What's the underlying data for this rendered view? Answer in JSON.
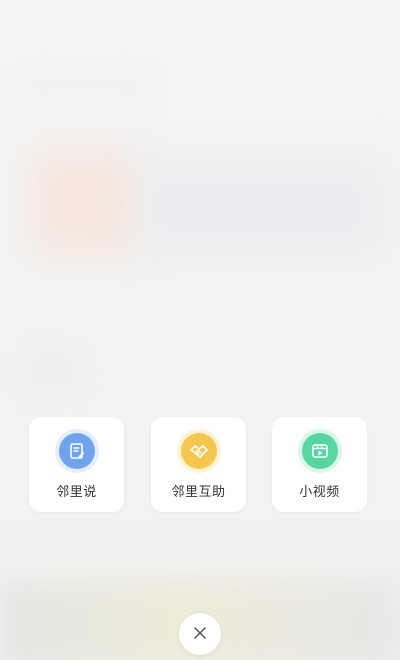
{
  "actions": [
    {
      "label": "邻里说",
      "icon": "note-edit-icon",
      "color": "#6fa3ec"
    },
    {
      "label": "邻里互助",
      "icon": "handshake-icon",
      "color": "#f4c750"
    },
    {
      "label": "小视频",
      "icon": "video-icon",
      "color": "#57d6a2"
    }
  ],
  "close": {
    "icon": "close-icon"
  }
}
